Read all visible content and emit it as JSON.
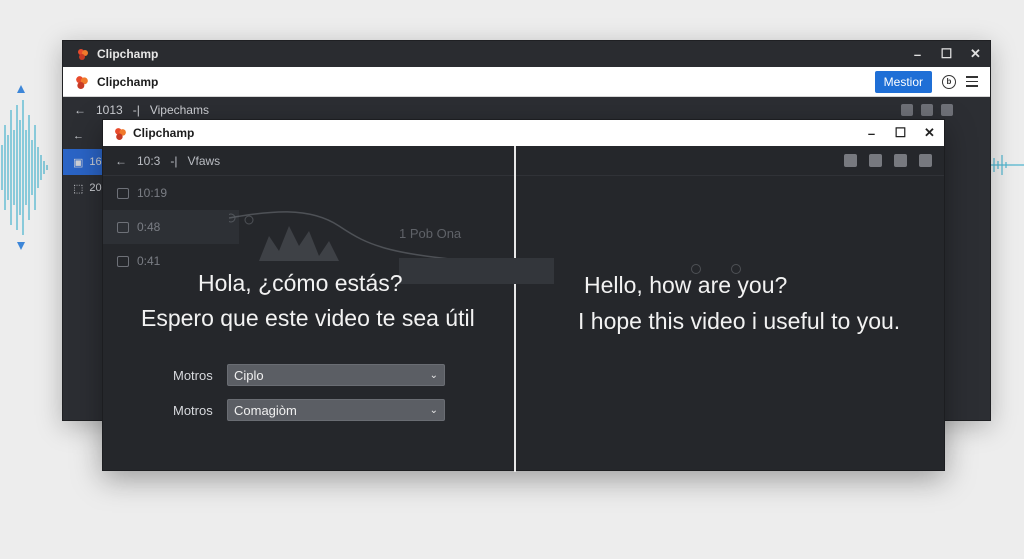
{
  "colors": {
    "accent": "#1f6fd6",
    "window_dark": "#25272b",
    "waveform": "#2aa8c8"
  },
  "back_window": {
    "title": "Clipchamp",
    "app_bar_title": "Clipchamp",
    "primary_button": "Mestior",
    "toolbar_time": "1013",
    "toolbar_sep": "-|",
    "toolbar_label": "Vipechams",
    "side_items": [
      "16",
      "20"
    ]
  },
  "front_window": {
    "title": "Clipchamp",
    "toolbar_time": "10:3",
    "toolbar_sep": "-|",
    "toolbar_label": "Vfaws",
    "media_items": [
      {
        "time": "10:19"
      },
      {
        "time": "0:48"
      },
      {
        "time": "0:41"
      }
    ],
    "ghost_label": "1 Pob Ona",
    "left_caption": {
      "line1": "Hola, ¿cómo estás?",
      "line2": "Espero que este video te sea útil"
    },
    "right_caption": {
      "line1": "Hello, how are you?",
      "line2": "I hope this video i useful to you."
    },
    "fields": [
      {
        "label": "Motros",
        "value": "Ciplo"
      },
      {
        "label": "Motros",
        "value": "Comagiòm"
      }
    ]
  }
}
